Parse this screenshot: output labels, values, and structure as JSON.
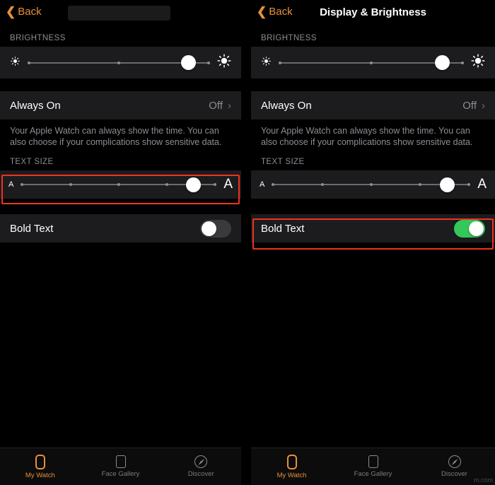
{
  "left": {
    "nav": {
      "back_label": "Back",
      "title": ""
    },
    "brightness": {
      "section_label": "BRIGHTNESS",
      "low_icon": "sun-small-icon",
      "high_icon": "sun-large-icon",
      "value_percent": 88
    },
    "always_on": {
      "title": "Always On",
      "value": "Off",
      "chevron": "›"
    },
    "footnote": "Your Apple Watch can always show the time. You can also choose if your complications show sensitive data.",
    "text_size": {
      "section_label": "TEXT SIZE",
      "small_label": "A",
      "large_label": "A",
      "value_percent": 88
    },
    "bold_text": {
      "title": "Bold Text",
      "state": "off"
    },
    "tabs": [
      {
        "label": "My Watch",
        "icon": "watch-icon",
        "active": true
      },
      {
        "label": "Face Gallery",
        "icon": "gallery-icon",
        "active": false
      },
      {
        "label": "Discover",
        "icon": "compass-icon",
        "active": false
      }
    ],
    "highlight_target": "text-size-slider"
  },
  "right": {
    "nav": {
      "back_label": "Back",
      "title": "Display & Brightness"
    },
    "brightness": {
      "section_label": "BRIGHTNESS",
      "low_icon": "sun-small-icon",
      "high_icon": "sun-large-icon",
      "value_percent": 88
    },
    "always_on": {
      "title": "Always On",
      "value": "Off",
      "chevron": "›"
    },
    "footnote": "Your Apple Watch can always show the time. You can also choose if your complications show sensitive data.",
    "text_size": {
      "section_label": "TEXT SIZE",
      "small_label": "A",
      "large_label": "A",
      "value_percent": 88
    },
    "bold_text": {
      "title": "Bold Text",
      "state": "on"
    },
    "tabs": [
      {
        "label": "My Watch",
        "icon": "watch-icon",
        "active": true
      },
      {
        "label": "Face Gallery",
        "icon": "gallery-icon",
        "active": false
      },
      {
        "label": "Discover",
        "icon": "compass-icon",
        "active": false
      }
    ],
    "highlight_target": "bold-text-row",
    "watermark": "m.com"
  },
  "colors": {
    "accent": "#e8903a",
    "highlight": "#f0321e",
    "toggle_on": "#34c759",
    "cell_bg": "#1c1c1e",
    "secondary_text": "#8d8d93"
  }
}
